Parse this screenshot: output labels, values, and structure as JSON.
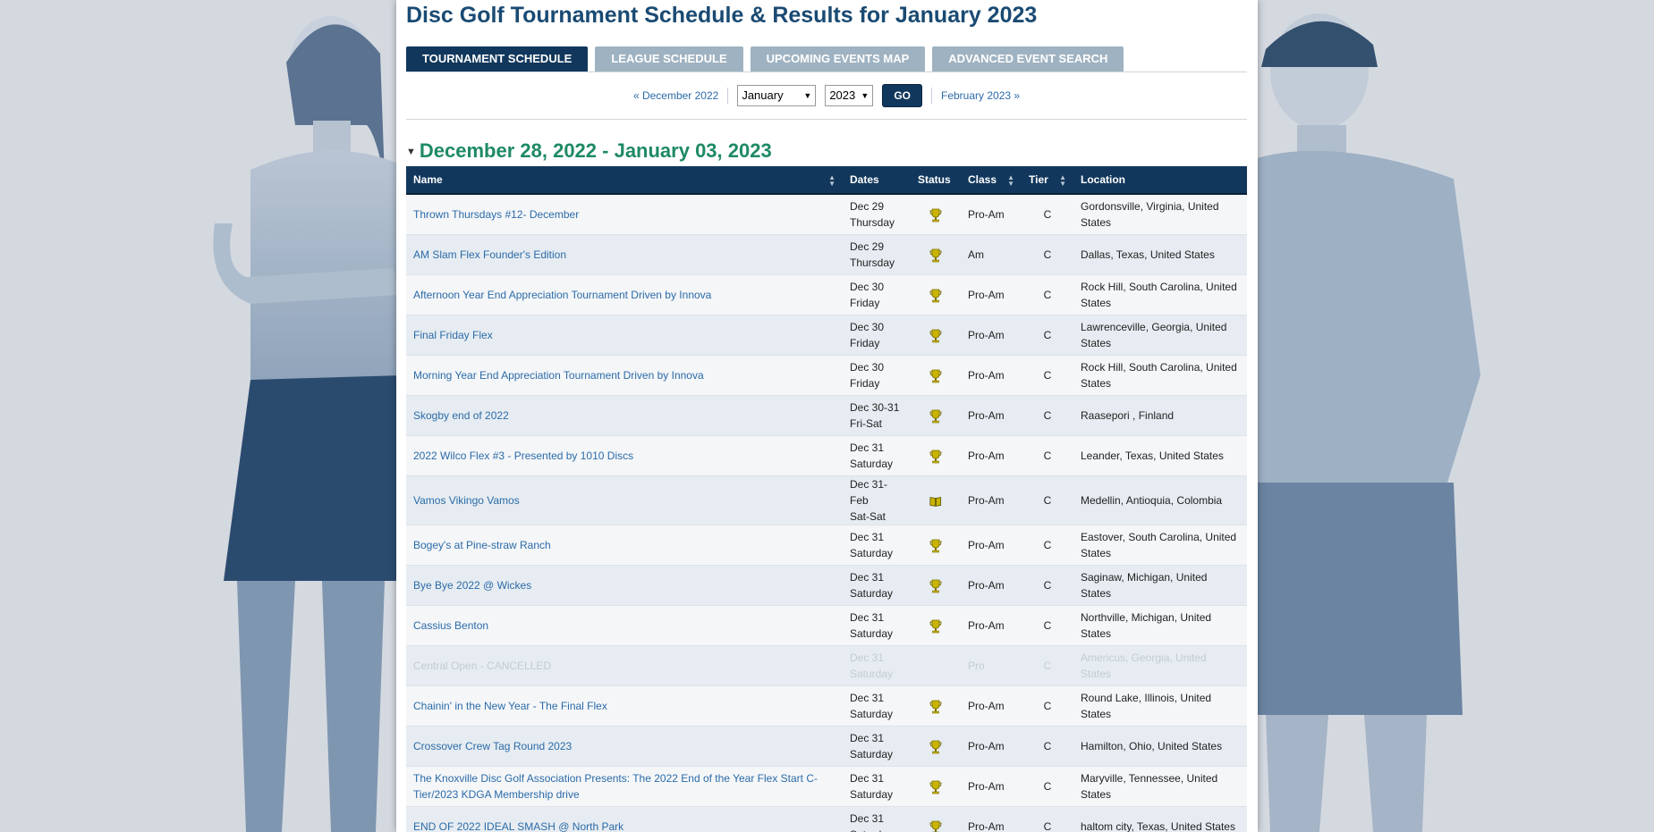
{
  "page_title": "Disc Golf Tournament Schedule & Results for January 2023",
  "tabs": [
    {
      "label": "TOURNAMENT SCHEDULE",
      "active": true
    },
    {
      "label": "LEAGUE SCHEDULE",
      "active": false
    },
    {
      "label": "UPCOMING EVENTS MAP",
      "active": false
    },
    {
      "label": "ADVANCED EVENT SEARCH",
      "active": false
    }
  ],
  "month_nav": {
    "prev_label": "« December 2022",
    "month_value": "January",
    "year_value": "2023",
    "go_label": "GO",
    "next_label": "February 2023 »"
  },
  "week_heading": "December 28, 2022 - January 03, 2023",
  "columns": {
    "name": "Name",
    "dates": "Dates",
    "status": "Status",
    "class": "Class",
    "tier": "Tier",
    "location": "Location"
  },
  "colors": {
    "header_bg": "#11375c",
    "link": "#2c6ba8",
    "week_heading": "#1e8a63",
    "trophy": "#c9b400"
  },
  "events": [
    {
      "name": "Thrown Thursdays #12- December",
      "date1": "Dec 29",
      "date2": "Thursday",
      "status_icon": "trophy-icon",
      "class": "Pro-Am",
      "tier": "C",
      "location": "Gordonsville, Virginia, United States",
      "cancelled": false
    },
    {
      "name": "AM Slam Flex Founder's Edition",
      "date1": "Dec 29",
      "date2": "Thursday",
      "status_icon": "trophy-icon",
      "class": "Am",
      "tier": "C",
      "location": "Dallas, Texas, United States",
      "cancelled": false
    },
    {
      "name": "Afternoon Year End Appreciation Tournament Driven by Innova",
      "date1": "Dec 30",
      "date2": "Friday",
      "status_icon": "trophy-icon",
      "class": "Pro-Am",
      "tier": "C",
      "location": "Rock Hill, South Carolina, United States",
      "cancelled": false
    },
    {
      "name": "Final Friday Flex",
      "date1": "Dec 30",
      "date2": "Friday",
      "status_icon": "trophy-icon",
      "class": "Pro-Am",
      "tier": "C",
      "location": "Lawrenceville, Georgia, United States",
      "cancelled": false
    },
    {
      "name": "Morning Year End Appreciation Tournament Driven by Innova",
      "date1": "Dec 30",
      "date2": "Friday",
      "status_icon": "trophy-icon",
      "class": "Pro-Am",
      "tier": "C",
      "location": "Rock Hill, South Carolina, United States",
      "cancelled": false
    },
    {
      "name": "Skogby end of 2022",
      "date1": "Dec 30-31",
      "date2": "Fri-Sat",
      "status_icon": "trophy-icon",
      "class": "Pro-Am",
      "tier": "C",
      "location": "Raasepori , Finland",
      "cancelled": false
    },
    {
      "name": "2022 Wilco Flex #3 - Presented by 1010 Discs",
      "date1": "Dec 31",
      "date2": "Saturday",
      "status_icon": "trophy-icon",
      "class": "Pro-Am",
      "tier": "C",
      "location": "Leander, Texas, United States",
      "cancelled": false
    },
    {
      "name": "Vamos Vikingo Vamos",
      "date1": "Dec 31-Feb",
      "date2": "Sat-Sat",
      "status_icon": "book-icon",
      "class": "Pro-Am",
      "tier": "C",
      "location": "Medellin, Antioquia, Colombia",
      "cancelled": false
    },
    {
      "name": "Bogey's at Pine-straw Ranch",
      "date1": "Dec 31",
      "date2": "Saturday",
      "status_icon": "trophy-icon",
      "class": "Pro-Am",
      "tier": "C",
      "location": "Eastover, South Carolina, United States",
      "cancelled": false
    },
    {
      "name": "Bye Bye 2022 @ Wickes",
      "date1": "Dec 31",
      "date2": "Saturday",
      "status_icon": "trophy-icon",
      "class": "Pro-Am",
      "tier": "C",
      "location": "Saginaw, Michigan, United States",
      "cancelled": false
    },
    {
      "name": "Cassius Benton",
      "date1": "Dec 31",
      "date2": "Saturday",
      "status_icon": "trophy-icon",
      "class": "Pro-Am",
      "tier": "C",
      "location": "Northville, Michigan, United States",
      "cancelled": false
    },
    {
      "name": "Central Open",
      "suffix": " - CANCELLED",
      "date1": "Dec 31",
      "date2": "Saturday",
      "status_icon": "",
      "class": "Pro",
      "tier": "C",
      "location": "Americus, Georgia, United States",
      "cancelled": true
    },
    {
      "name": "Chainin' in the New Year - The Final Flex",
      "date1": "Dec 31",
      "date2": "Saturday",
      "status_icon": "trophy-icon",
      "class": "Pro-Am",
      "tier": "C",
      "location": "Round Lake, Illinois, United States",
      "cancelled": false
    },
    {
      "name": "Crossover Crew Tag Round 2023",
      "date1": "Dec 31",
      "date2": "Saturday",
      "status_icon": "trophy-icon",
      "class": "Pro-Am",
      "tier": "C",
      "location": "Hamilton, Ohio, United States",
      "cancelled": false
    },
    {
      "name": "The Knoxville Disc Golf Association Presents: The 2022 End of the Year Flex Start C-Tier/2023 KDGA Membership drive",
      "date1": "Dec 31",
      "date2": "Saturday",
      "status_icon": "trophy-icon",
      "class": "Pro-Am",
      "tier": "C",
      "location": "Maryville, Tennessee, United States",
      "cancelled": false
    },
    {
      "name": "END OF 2022 IDEAL SMASH @ North Park",
      "date1": "Dec 31",
      "date2": "Saturday",
      "status_icon": "trophy-icon",
      "class": "Pro-Am",
      "tier": "C",
      "location": "haltom city, Texas, United States",
      "cancelled": false
    }
  ]
}
